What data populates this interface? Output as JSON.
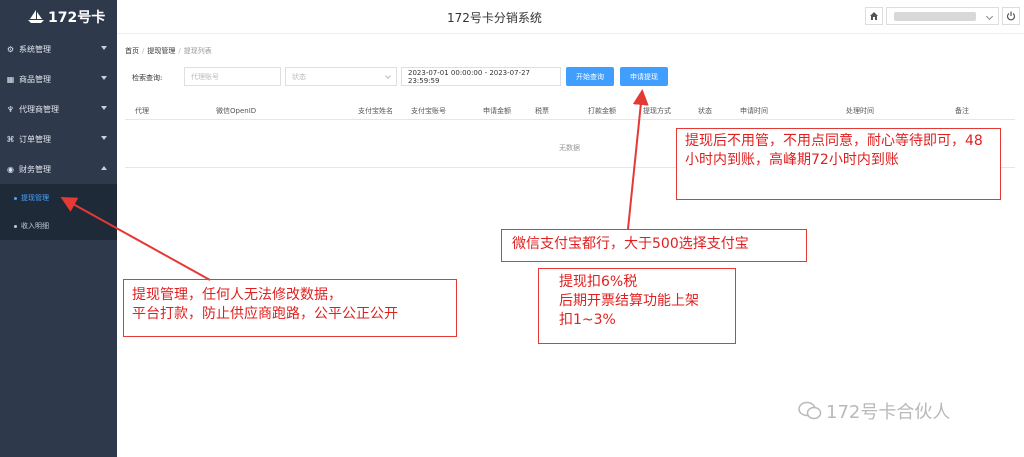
{
  "brand": {
    "name": "172号卡"
  },
  "header": {
    "title": "172号卡分销系统",
    "home_icon": "home-icon",
    "power_icon": "power-icon"
  },
  "sidebar": {
    "items": [
      {
        "label": "系统管理",
        "icon": "gear-icon"
      },
      {
        "label": "商品管理",
        "icon": "grid-icon"
      },
      {
        "label": "代理商管理",
        "icon": "share-icon"
      },
      {
        "label": "订单管理",
        "icon": "order-icon"
      },
      {
        "label": "财务管理",
        "icon": "coin-icon"
      }
    ],
    "finance_sub": [
      {
        "label": "提现管理"
      },
      {
        "label": "收入明细"
      }
    ]
  },
  "breadcrumb": {
    "home": "首页",
    "section": "提现管理",
    "current": "提现列表"
  },
  "search": {
    "label": "检索查询:",
    "agent_placeholder": "代理账号",
    "status_placeholder": "状态",
    "date_range": "2023-07-01 00:00:00 - 2023-07-27 23:59:59",
    "query_button": "开始查询",
    "apply_button": "申请提现"
  },
  "table": {
    "columns": [
      "代理",
      "微信OpenID",
      "支付宝姓名",
      "支付宝账号",
      "申请金额",
      "税票",
      "打款金额",
      "提现方式",
      "状态",
      "申请时间",
      "处理时间",
      "备注"
    ],
    "empty_text": "无数据"
  },
  "annotations": {
    "top_right": "提现后不用管，不用点同意，耐心等待即可，48小时内到账，高峰期72小时内到账",
    "middle": "微信支付宝都行，大于500选择支付宝",
    "left_line1": "提现管理，任何人无法修改数据，",
    "left_line2": "平台打款，防止供应商跑路，公平公正公开",
    "tax_line1": "提现扣6%税",
    "tax_line2": "后期开票结算功能上架",
    "tax_line3": "扣1~3%",
    "accent_color": "#e53935"
  },
  "watermark": {
    "text": "172号卡合伙人"
  },
  "colors": {
    "sidebar": "#2e3a4c",
    "primary": "#409eff"
  }
}
